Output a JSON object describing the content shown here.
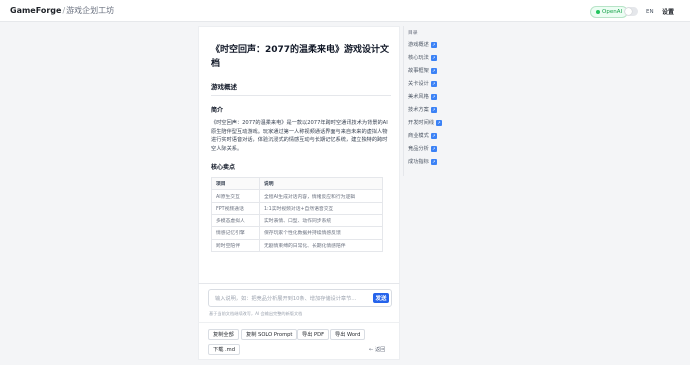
{
  "header": {
    "brand": "GameForge",
    "separator": "/",
    "subtitle": "游戏企划工坊",
    "model_badge": "OpenAI",
    "lang_label": "EN",
    "settings_label": "设置"
  },
  "document": {
    "title": "《时空回声：2077的温柔来电》游戏设计文档",
    "section_overview": "游戏概述",
    "subsection_intro": "简介",
    "intro_text": "《时空回声：2077的温柔来电》是一款以2077年跨时空通讯技术为背景的AI原生陪伴型互动游戏。玩家通过第一人称视频通话界面与来自未来的虚拟人物进行实时语音对话，体验沉浸式的情感互动与长期记忆系统，建立独特的跨时空人际关系。",
    "subsection_features": "核心卖点",
    "table_headers": [
      "项目",
      "说明"
    ],
    "table_rows": [
      [
        "AI原生交互",
        "全程AI生成对话内容，情绪反应和行为逻辑"
      ],
      [
        "FPT视频通话",
        "1:1实时视频对话+自然语音交互"
      ],
      [
        "多模态虚拟人",
        "实时表情、口型、动作同步系统"
      ],
      [
        "情感记忆引擎",
        "保存玩家个性化数据并持续情感反馈"
      ],
      [
        "跨时空陪伴",
        "无剧情束缚的日常化、长期化情感陪伴"
      ]
    ]
  },
  "chat": {
    "placeholder": "输入说明，如：把竞品分析展开到10条、增加存储设计章节…",
    "send_label": "发送",
    "hint": "基于当前文档继续改写，AI 会输出完整的新版文档"
  },
  "actions": {
    "copy_all": "复制全部",
    "copy_solo": "复制 SOLO Prompt",
    "export_pdf": "导出 PDF",
    "export_word": "导出 Word",
    "download_md": "下载 .md",
    "back": "← 返回"
  },
  "toc": {
    "title": "目录",
    "items": [
      "游戏概述",
      "核心玩法",
      "故事框架",
      "关卡设计",
      "美术风格",
      "技术方案",
      "开发时间线",
      "商业模式",
      "竞品分析",
      "成功指标"
    ]
  }
}
